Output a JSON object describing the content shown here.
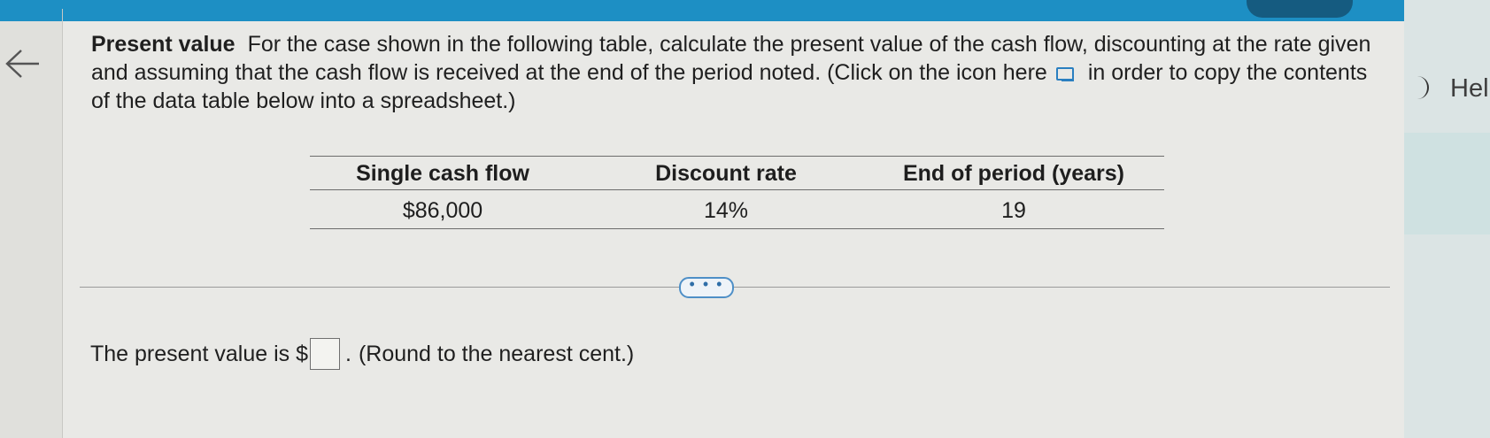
{
  "question": {
    "title": "Present value",
    "text": "For the case shown in the following table, calculate the present value of the cash flow, discounting at the rate given and assuming that the cash flow is received at the end of the period noted. (Click on the icon here",
    "text_after_icon": "in order to copy the contents of the data table below into a spreadsheet.)"
  },
  "table": {
    "headers": [
      "Single cash flow",
      "Discount rate",
      "End of period (years)"
    ],
    "row": [
      "$86,000",
      "14%",
      "19"
    ]
  },
  "more_button_label": "• • •",
  "answer": {
    "prefix": "The present value is $",
    "suffix": ".",
    "note": "(Round to the nearest cent.)"
  },
  "side_panel": {
    "help_label": "Hel"
  },
  "icons": {
    "back": "back-arrow-icon",
    "copy": "copy-data-icon"
  },
  "colors": {
    "accent": "#1d8fc4",
    "link": "#2a7fc0"
  }
}
